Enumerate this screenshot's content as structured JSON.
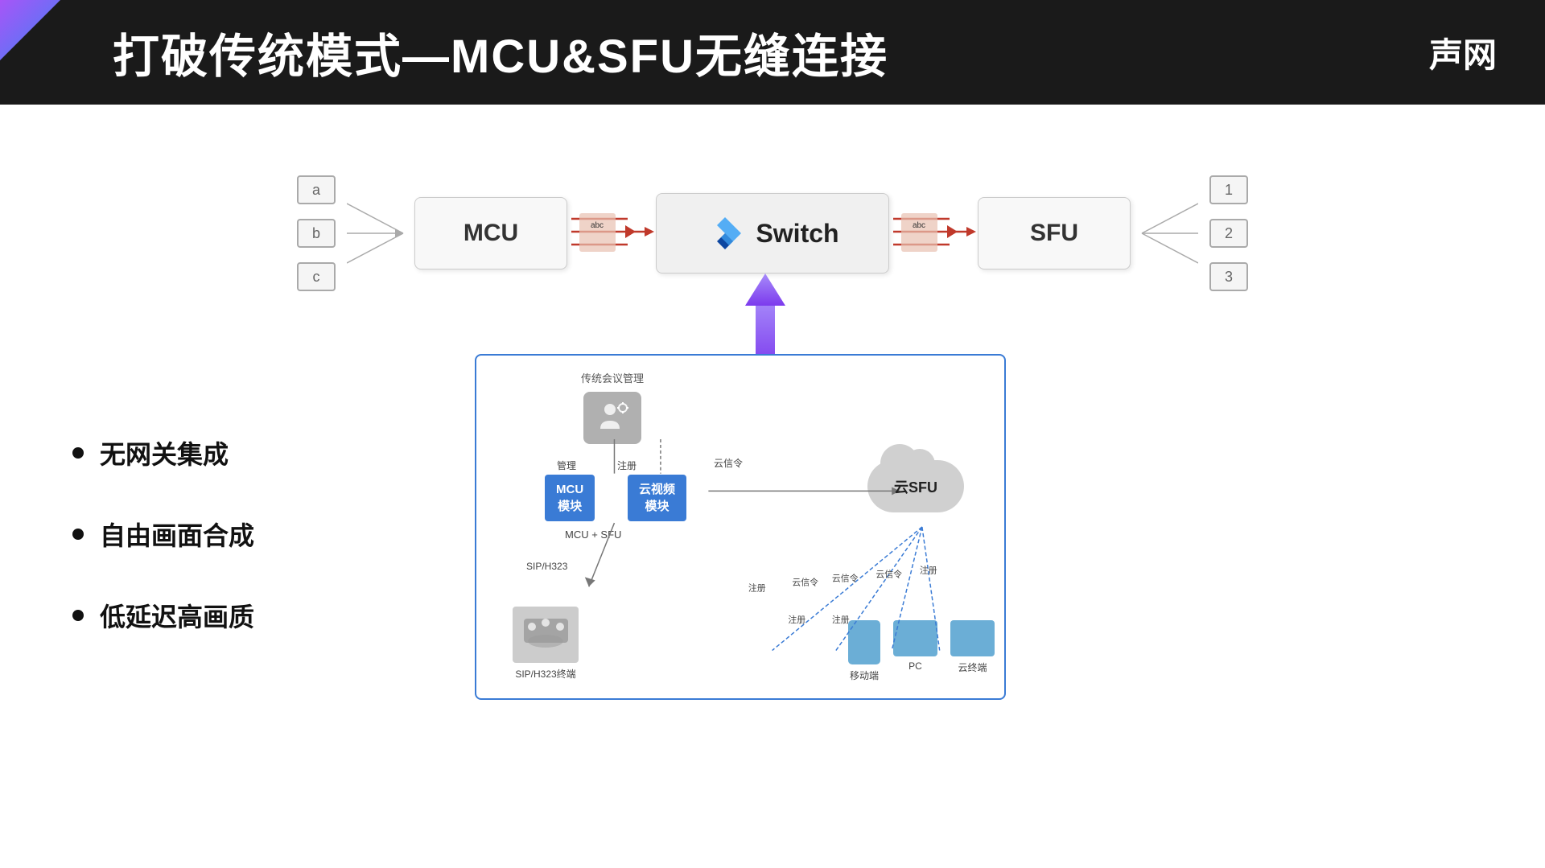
{
  "header": {
    "title": "打破传统模式—MCU&SFU无缝连接",
    "brand": "声网"
  },
  "diagram": {
    "mcu_label": "MCU",
    "switch_label": "Switch",
    "sfu_label": "SFU",
    "nodes_left": [
      "a",
      "b",
      "c"
    ],
    "nodes_right": [
      "1",
      "2",
      "3"
    ]
  },
  "bullet_points": [
    "无网关集成",
    "自由画面合成",
    "低延迟高画质"
  ],
  "internal": {
    "conf_mgmt": "传统会议管理",
    "mgmt_label": "管理",
    "register_label": "注册",
    "mcu_module": "MCU\n模块",
    "cloud_video": "云视频\n模块",
    "mcu_sfu": "MCU + SFU",
    "cloud_sfu": "云SFU",
    "sip_h323": "SIP/H323",
    "sip_h323_terminal": "SIP/H323终端",
    "cloud_signal": "云信令",
    "mobile": "移动端",
    "pc": "PC",
    "cloud_terminal": "云终端",
    "register": "注册",
    "cloud_signal_labels": [
      "云信令",
      "云信令",
      "云信令"
    ]
  }
}
